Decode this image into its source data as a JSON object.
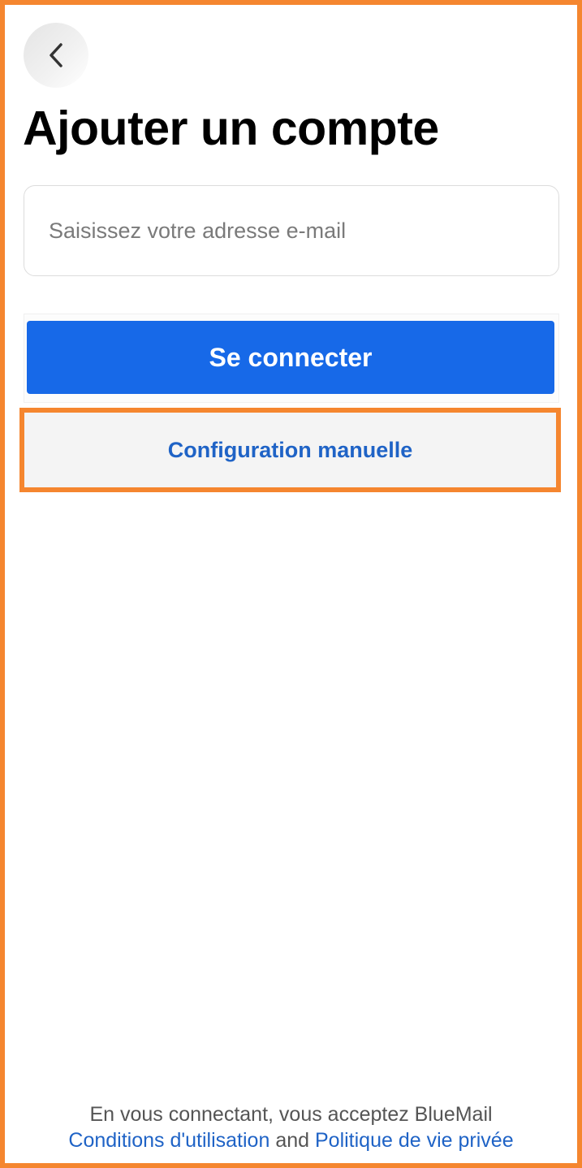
{
  "header": {
    "back_icon": "chevron-left-icon",
    "title": "Ajouter un compte"
  },
  "form": {
    "email_placeholder": "Saisissez votre adresse e-mail",
    "email_value": "",
    "signin_label": "Se connecter",
    "manual_label": "Configuration manuelle"
  },
  "footer": {
    "line1": "En vous connectant, vous acceptez BlueMail",
    "terms_link": "Conditions d'utilisation",
    "joiner": "and",
    "privacy_link": "Politique de vie privée"
  },
  "colors": {
    "accent_blue": "#1769e8",
    "link_blue": "#1f63c6",
    "highlight_orange": "#f5862f"
  }
}
